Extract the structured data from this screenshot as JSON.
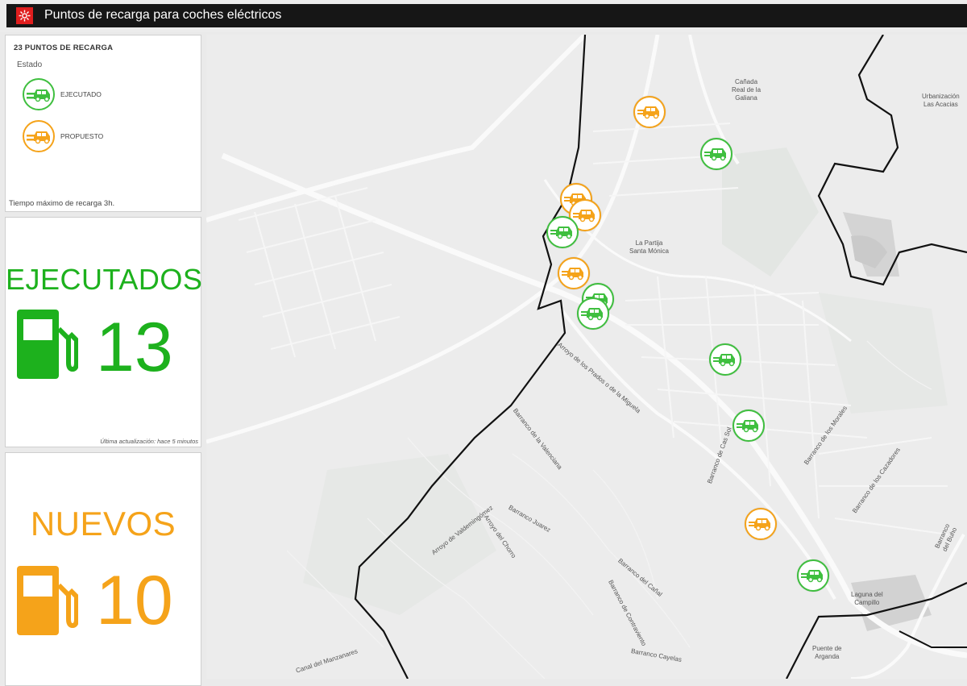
{
  "app": {
    "title": "Puntos de recarga para coches eléctricos"
  },
  "legend": {
    "header": "23 PUNTOS DE RECARGA",
    "field": "Estado",
    "items": [
      {
        "label": "EJECUTADO",
        "color": "#3fbf3f"
      },
      {
        "label": "PROPUESTO",
        "color": "#f5a31a"
      }
    ],
    "footer": "Tiempo máximo de recarga 3h."
  },
  "kpi_executed": {
    "label": "EJECUTADOS",
    "value": "13",
    "updated": "Última actualización: hace 5 minutos",
    "color": "#1db11d"
  },
  "kpi_new": {
    "label": "NUEVOS",
    "value": "10",
    "color": "#f5a31a"
  },
  "map": {
    "places": [
      "Cañada",
      "Real de la",
      "Galiana",
      "Urbanización",
      "Las Acacias",
      "La Partija",
      "Santa Mónica",
      "Laguna del",
      "Campillo",
      "Puente de",
      "Arganda"
    ],
    "streets": [
      "Arroyo de los Prados o de la Miguela",
      "Barranco de la Valenciana",
      "Barranco Juarez",
      "Arroyo del Chorro",
      "Arroyo de Valdemingómez",
      "Barranco de Cas Sol",
      "Barranco de los Morales",
      "Barranco de los Cazadores",
      "Barranco del Buho",
      "Barranco del Cañal",
      "Barranco de Contraviento",
      "Canal del Manzanares",
      "Barranco Cayelas"
    ]
  }
}
